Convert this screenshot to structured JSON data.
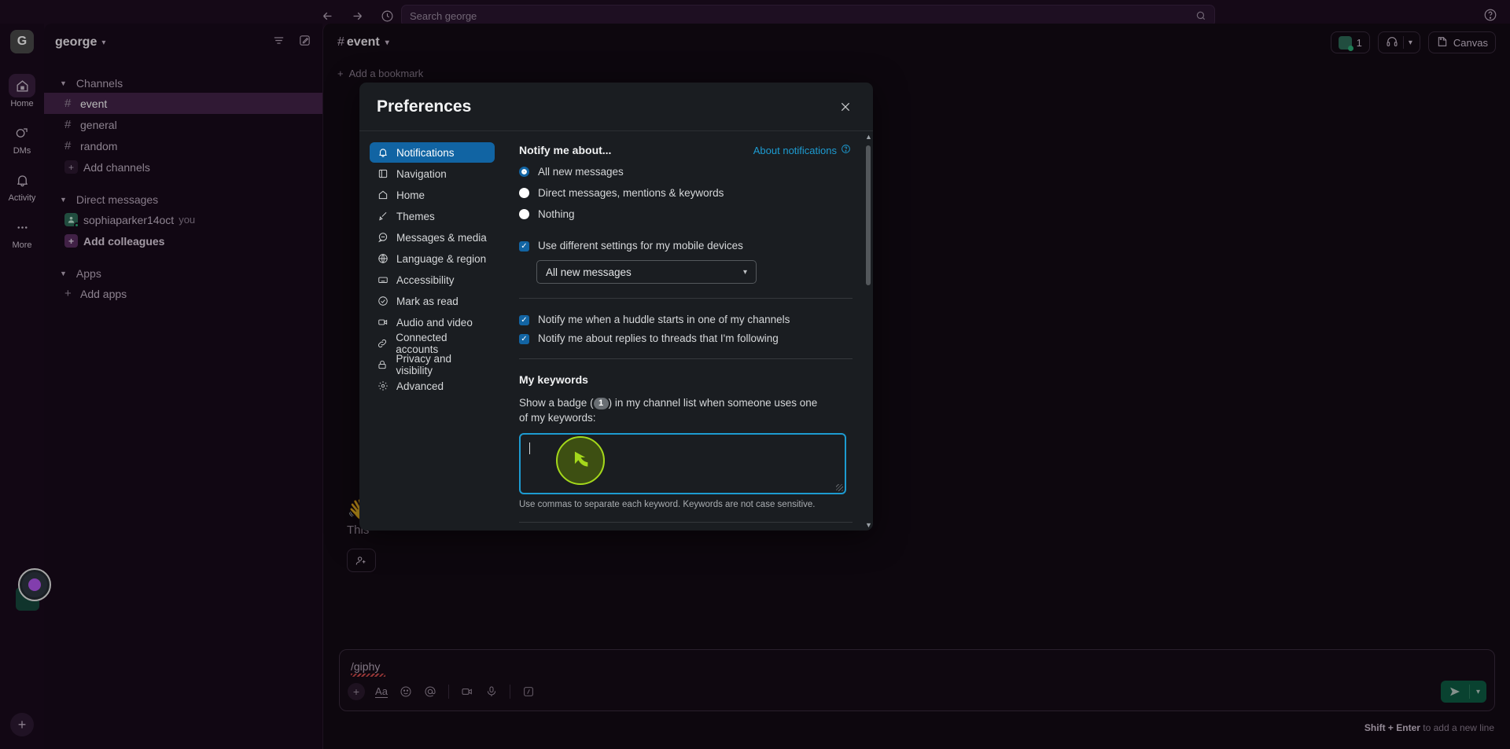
{
  "topbar": {
    "back_icon": "arrow-left-icon",
    "forward_icon": "arrow-right-icon",
    "history_icon": "clock-icon",
    "search_placeholder": "Search george",
    "help_icon": "question-circle-icon"
  },
  "rail": {
    "workspace_initial": "G",
    "items": [
      {
        "label": "Home",
        "icon": "home-icon",
        "active": true
      },
      {
        "label": "DMs",
        "icon": "dm-icon",
        "active": false
      },
      {
        "label": "Activity",
        "icon": "bell-icon",
        "active": false
      },
      {
        "label": "More",
        "icon": "ellipsis-icon",
        "active": false
      }
    ],
    "add_label": "+"
  },
  "sidebar": {
    "workspace_name": "george",
    "filter_icon": "filter-icon",
    "compose_icon": "compose-icon",
    "sections": [
      {
        "title": "Channels",
        "rows": [
          {
            "label": "event",
            "type": "channel",
            "active": true
          },
          {
            "label": "general",
            "type": "channel",
            "active": false
          },
          {
            "label": "random",
            "type": "channel",
            "active": false
          },
          {
            "label": "Add channels",
            "type": "add",
            "active": false
          }
        ]
      },
      {
        "title": "Direct messages",
        "rows": [
          {
            "label": "sophiaparker14oct",
            "type": "dm",
            "suffix": "you",
            "active": false
          },
          {
            "label": "Add colleagues",
            "type": "add-accent",
            "active": false
          }
        ]
      },
      {
        "title": "Apps",
        "rows": [
          {
            "label": "Add apps",
            "type": "add-plain",
            "active": false
          }
        ]
      }
    ]
  },
  "channel": {
    "hash": "#",
    "name": "event",
    "chevron": "chevron-down-icon",
    "member_count": "1",
    "huddle_icon": "headphones-icon",
    "canvas_label": "Canvas",
    "bookmark_label": "Add a bookmark",
    "wave_emoji": "👋",
    "intro_text": "This",
    "composer_value": "/giphy",
    "composer_tools": [
      "plus-icon",
      "Aa",
      "emoji-icon",
      "mention-icon",
      "video-icon",
      "mic-icon",
      "slash-icon"
    ],
    "send_icon": "send-icon",
    "send_chevron": "chevron-down-icon",
    "hint_bold": "Shift + Enter",
    "hint_rest": " to add a new line"
  },
  "modal": {
    "title": "Preferences",
    "close_icon": "close-icon",
    "nav": [
      {
        "label": "Notifications",
        "icon": "bell-icon",
        "active": true
      },
      {
        "label": "Navigation",
        "icon": "navigation-icon",
        "active": false
      },
      {
        "label": "Home",
        "icon": "home-icon",
        "active": false
      },
      {
        "label": "Themes",
        "icon": "brush-icon",
        "active": false
      },
      {
        "label": "Messages & media",
        "icon": "message-icon",
        "active": false
      },
      {
        "label": "Language & region",
        "icon": "globe-icon",
        "active": false
      },
      {
        "label": "Accessibility",
        "icon": "keyboard-icon",
        "active": false
      },
      {
        "label": "Mark as read",
        "icon": "check-circle-icon",
        "active": false
      },
      {
        "label": "Audio and video",
        "icon": "video-icon",
        "active": false
      },
      {
        "label": "Connected accounts",
        "icon": "link-icon",
        "active": false
      },
      {
        "label": "Privacy and visibility",
        "icon": "lock-icon",
        "active": false
      },
      {
        "label": "Advanced",
        "icon": "gear-icon",
        "active": false
      }
    ],
    "notify": {
      "section_title": "Notify me about...",
      "about_link": "About notifications",
      "about_icon": "question-circle-icon",
      "options": [
        {
          "label": "All new messages",
          "selected": true
        },
        {
          "label": "Direct messages, mentions & keywords",
          "selected": false
        },
        {
          "label": "Nothing",
          "selected": false
        }
      ],
      "mobile_checkbox": {
        "label": "Use different settings for my mobile devices",
        "checked": true
      },
      "mobile_select_value": "All new messages",
      "mobile_select_chevron": "chevron-down-icon",
      "extra_checkboxes": [
        {
          "label": "Notify me when a huddle starts in one of my channels",
          "checked": true
        },
        {
          "label": "Notify me about replies to threads that I'm following",
          "checked": true
        }
      ]
    },
    "keywords": {
      "title": "My keywords",
      "desc_before": "Show a badge (",
      "badge": "1",
      "desc_after": ") in my channel list when someone uses one of my keywords:",
      "textarea_value": "",
      "help": "Use commas to separate each keyword. Keywords are not case sensitive."
    },
    "scroll_up_icon": "caret-up-icon",
    "scroll_down_icon": "caret-down-icon"
  },
  "cursor": {
    "pointer_icon": "arrow-pointer-icon",
    "ring_color": "#a4d81b",
    "fill_color": "#3d4f12"
  }
}
